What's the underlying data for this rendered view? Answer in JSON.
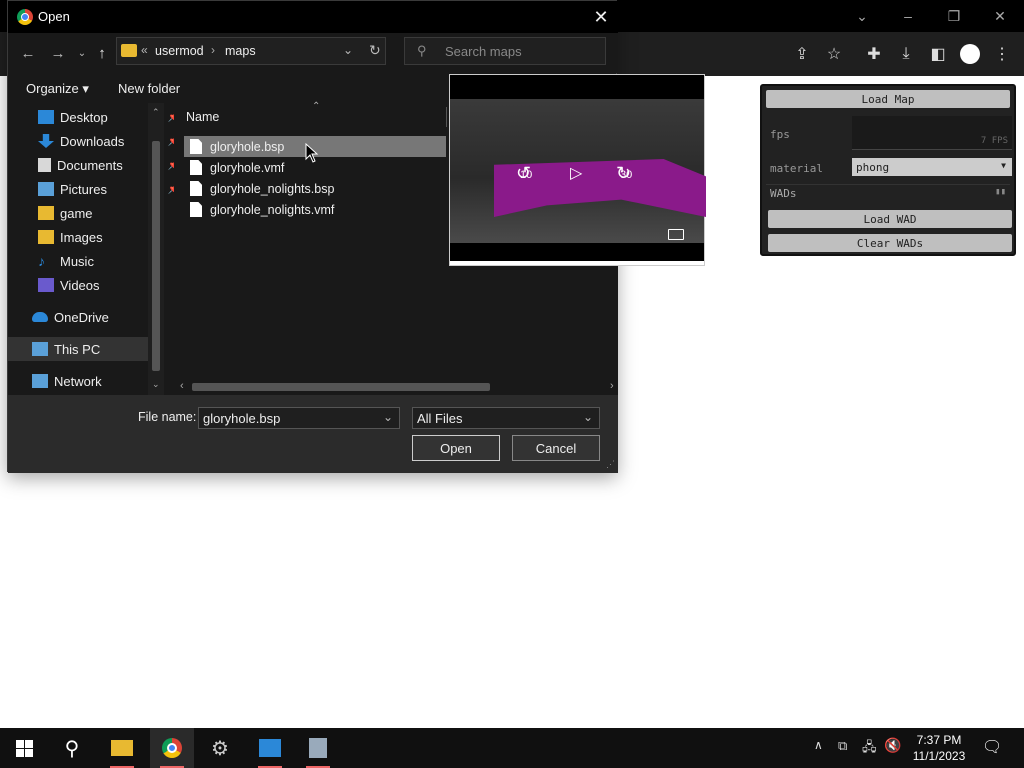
{
  "dialog": {
    "title": "Open",
    "address": {
      "prefix": "«",
      "crumb1": "usermod",
      "crumb2": "maps"
    },
    "search_placeholder": "Search maps",
    "organize_label": "Organize ▾",
    "new_folder_label": "New folder",
    "column_name": "Name",
    "nav_items": [
      {
        "label": "Desktop",
        "icon": "desktop-icon",
        "pinned": true
      },
      {
        "label": "Downloads",
        "icon": "downloads-icon",
        "pinned": true
      },
      {
        "label": "Documents",
        "icon": "documents-icon",
        "pinned": true
      },
      {
        "label": "Pictures",
        "icon": "pictures-icon",
        "pinned": true
      },
      {
        "label": "game",
        "icon": "folder-icon",
        "pinned": false
      },
      {
        "label": "Images",
        "icon": "folder-icon",
        "pinned": false
      },
      {
        "label": "Music",
        "icon": "music-icon",
        "pinned": false
      },
      {
        "label": "Videos",
        "icon": "videos-icon",
        "pinned": false
      },
      {
        "label": "OneDrive",
        "icon": "onedrive-icon",
        "pinned": false
      },
      {
        "label": "This PC",
        "icon": "this-pc-icon",
        "pinned": false
      },
      {
        "label": "Network",
        "icon": "network-icon",
        "pinned": false
      }
    ],
    "files": [
      {
        "name": "gloryhole.bsp",
        "selected": true
      },
      {
        "name": "gloryhole.vmf",
        "selected": false
      },
      {
        "name": "gloryhole_nolights.bsp",
        "selected": false
      },
      {
        "name": "gloryhole_nolights.vmf",
        "selected": false
      }
    ],
    "filename_label": "File name:",
    "filename_value": "gloryhole.bsp",
    "filetype_value": "All Files",
    "open_label": "Open",
    "cancel_label": "Cancel"
  },
  "preview": {
    "rewind_label": "10",
    "forward_label": "30"
  },
  "map_panel": {
    "load_map": "Load Map",
    "fps_label": "fps",
    "fps_value": "7 FPS",
    "material_label": "material",
    "material_value": "phong",
    "wads_label": "WADs",
    "load_wad": "Load WAD",
    "clear_wads": "Clear WADs"
  },
  "taskbar": {
    "time": "7:37 PM",
    "date": "11/1/2023"
  },
  "colors": {
    "accent_folder": "#e8b931",
    "magenta": "#8a1a8a",
    "selection": "#777777"
  }
}
